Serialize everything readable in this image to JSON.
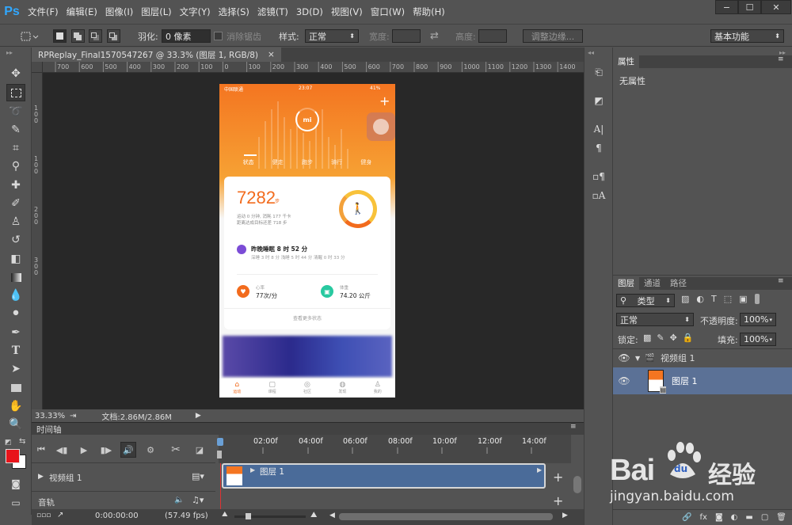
{
  "app": {
    "logo": "Ps",
    "menu": [
      "文件(F)",
      "编辑(E)",
      "图像(I)",
      "图层(L)",
      "文字(Y)",
      "选择(S)",
      "滤镜(T)",
      "3D(D)",
      "视图(V)",
      "窗口(W)",
      "帮助(H)"
    ],
    "window_buttons": [
      "−",
      "☐",
      "✕"
    ]
  },
  "options": {
    "feather_label": "羽化:",
    "feather_value": "0 像素",
    "antialias_label": "消除锯齿",
    "style_label": "样式:",
    "style_value": "正常",
    "width_label": "宽度:",
    "height_label": "高度:",
    "refine_button": "调整边缘...",
    "workspace": "基本功能"
  },
  "document": {
    "tab_title": "RPReplay_Final1570547267 @ 33.3% (图层 1, RGB/8)",
    "tab_close": "×",
    "zoom": "33.33%",
    "doc_size": "文档:2.86M/2.86M"
  },
  "ruler_top": [
    "700",
    "600",
    "500",
    "400",
    "300",
    "200",
    "100",
    "0",
    "100",
    "200",
    "300",
    "400",
    "500",
    "600",
    "700",
    "800",
    "900",
    "1000",
    "1100",
    "1200",
    "1300",
    "1400"
  ],
  "ruler_left": [
    "1",
    "0",
    "0",
    "1",
    "0",
    "0",
    "2",
    "0",
    "0",
    "3",
    "0",
    "0"
  ],
  "phone": {
    "carrier": "中国联通",
    "time": "23:07",
    "battery": "41%",
    "plus": "+",
    "logo": "mi",
    "tabs": [
      "状态",
      "健走",
      "跑步",
      "骑行",
      "健身"
    ],
    "steps": "7282",
    "steps_unit": "步",
    "steps_line1": "运动 0 分钟, 消耗 177 千卡",
    "steps_line2": "距离达成目标还差 718 步",
    "sleep_title": "昨晚睡眠 8 时 52 分",
    "sleep_detail": "深睡 3 时 8 分  浅睡 5 时 44 分  清醒 0 时 33 分",
    "heart_label": "心率",
    "heart_value": "77次/分",
    "weight_label": "体重",
    "weight_value": "74.20 公斤",
    "more": "查看更多状态",
    "nav": [
      "运动",
      "课程",
      "社区",
      "发现",
      "我的"
    ]
  },
  "timeline": {
    "panel_title": "时间轴",
    "ticks": [
      "02:00f",
      "04:00f",
      "06:00f",
      "08:00f",
      "10:00f",
      "12:00f",
      "14:00f"
    ],
    "group_name": "视频组 1",
    "clip_name": "图层 1",
    "audio_track": "音轨",
    "timecode": "0:00:00:00",
    "fps": "(57.49 fps)"
  },
  "properties": {
    "title": "属性",
    "no_properties": "无属性"
  },
  "layers_panel": {
    "tabs": [
      "图层",
      "通道",
      "路径"
    ],
    "filter_kind": "类型",
    "blend_mode": "正常",
    "opacity_label": "不透明度:",
    "opacity_value": "100%",
    "lock_label": "锁定:",
    "fill_label": "填充:",
    "fill_value": "100%",
    "layers": [
      {
        "name": "视频组 1",
        "type": "group"
      },
      {
        "name": "图层 1",
        "type": "layer",
        "selected": true
      }
    ]
  },
  "watermark": {
    "brand": "Bai",
    "paw": "du",
    "cn": "经验",
    "url": "jingyan.baidu.com"
  },
  "colors": {
    "foreground": "#e8141a",
    "background": "#ffffff",
    "accent_orange": "#f58a1f",
    "clip_blue": "#4a6b99"
  }
}
